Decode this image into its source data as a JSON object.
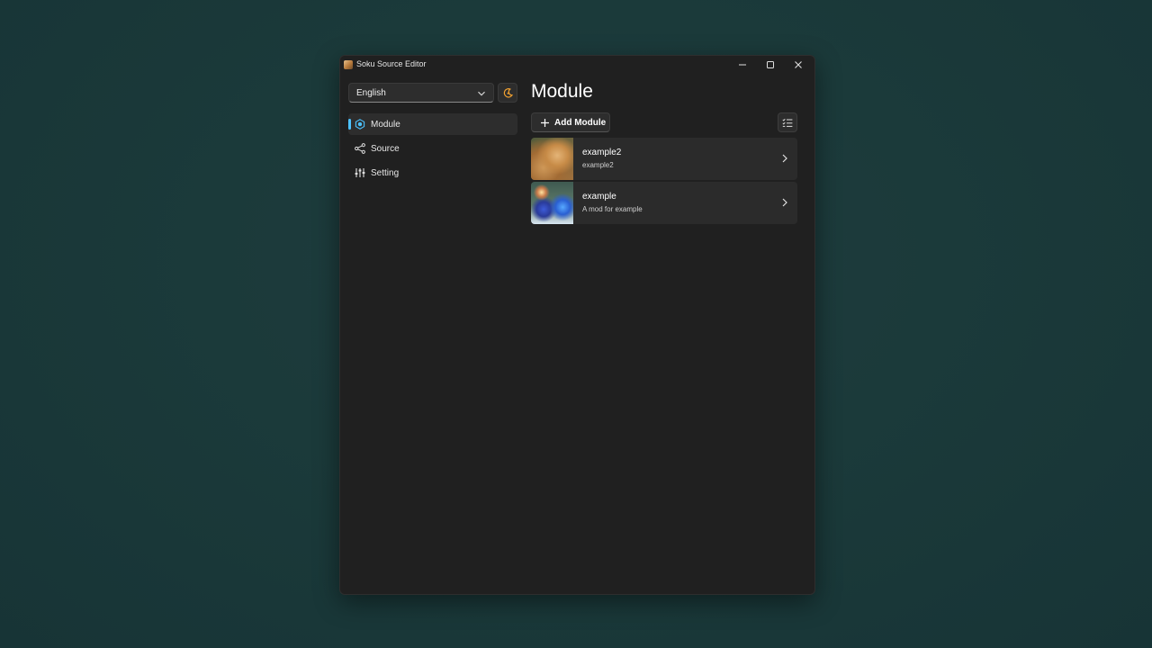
{
  "window": {
    "title": "Soku Source Editor"
  },
  "language_select": {
    "value": "English"
  },
  "nav": {
    "items": [
      {
        "label": "Module",
        "icon": "module-hexagon-icon",
        "selected": true
      },
      {
        "label": "Source",
        "icon": "share-nodes-icon",
        "selected": false
      },
      {
        "label": "Setting",
        "icon": "sliders-icon",
        "selected": false
      }
    ]
  },
  "main": {
    "title": "Module",
    "add_button_label": "Add Module",
    "modules": [
      {
        "name": "example2",
        "description": "example2"
      },
      {
        "name": "example",
        "description": "A mod for example"
      }
    ]
  },
  "colors": {
    "accent": "#4cc2ff",
    "theme_icon": "#f0a030",
    "window_bg": "#202020"
  }
}
